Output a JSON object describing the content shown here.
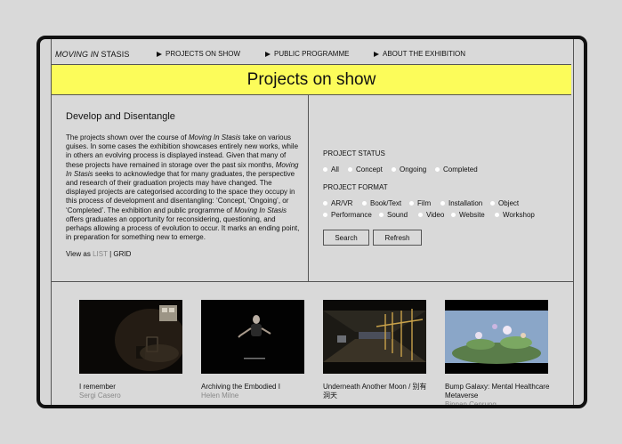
{
  "nav": {
    "brand_italic": "MOVING IN",
    "brand_rest": " STASIS",
    "items": [
      {
        "label": "PROJECTS ON SHOW"
      },
      {
        "label": "PUBLIC PROGRAMME"
      },
      {
        "label": "ABOUT THE EXHIBITION"
      }
    ]
  },
  "banner": {
    "title": "Projects on show"
  },
  "intro": {
    "heading": "Develop and Disentangle",
    "parts": [
      "The projects shown over the course of ",
      "Moving In Stasis",
      " take on various guises. In some cases the exhibition showcases entirely new works, while in others an evolving process is displayed instead. Given that many of these projects have remained in storage over the past six months, ",
      "Moving In Stasis",
      " seeks to acknowledge that for many graduates, the perspective and research of their graduation projects may have changed. The displayed projects are categorised according to the space they occupy in this process of development and disentangling: ‘Concept, ‘Ongoing’, or ‘Completed’. The exhibition and public programme of ",
      "Moving In Stasis",
      " offers graduates an opportunity for reconsidering, questioning, and perhaps allowing a process of evolution to occur. It marks an ending point, in preparation for something new to emerge."
    ],
    "view_as": "View as ",
    "view_list": "LIST",
    "view_sep": " | ",
    "view_grid": "GRID"
  },
  "filters": {
    "status_label": "PROJECT STATUS",
    "status_options": [
      "All",
      "Concept",
      "Ongoing",
      "Completed"
    ],
    "format_label": "PROJECT FORMAT",
    "format_options": [
      "AR/VR",
      "Book/Text",
      "Film",
      "Installation",
      "Object",
      "Performance",
      "Sound",
      "Video",
      "Website",
      "Workshop"
    ],
    "search_label": "Search",
    "refresh_label": "Refresh"
  },
  "projects": [
    {
      "title": "I remember",
      "artist": "Sergi Casero"
    },
    {
      "title": "Archiving the Embodied I",
      "artist": "Helen Milne"
    },
    {
      "title": "Underneath Another Moon / 别有洞天",
      "artist": ""
    },
    {
      "title": "Bump Galaxy: Mental Healthcare Metaverse",
      "artist": "Binnan Cenrung"
    }
  ],
  "colors": {
    "banner": "#fcfc5a",
    "background": "#d9d9d9",
    "muted_text": "#888888"
  }
}
